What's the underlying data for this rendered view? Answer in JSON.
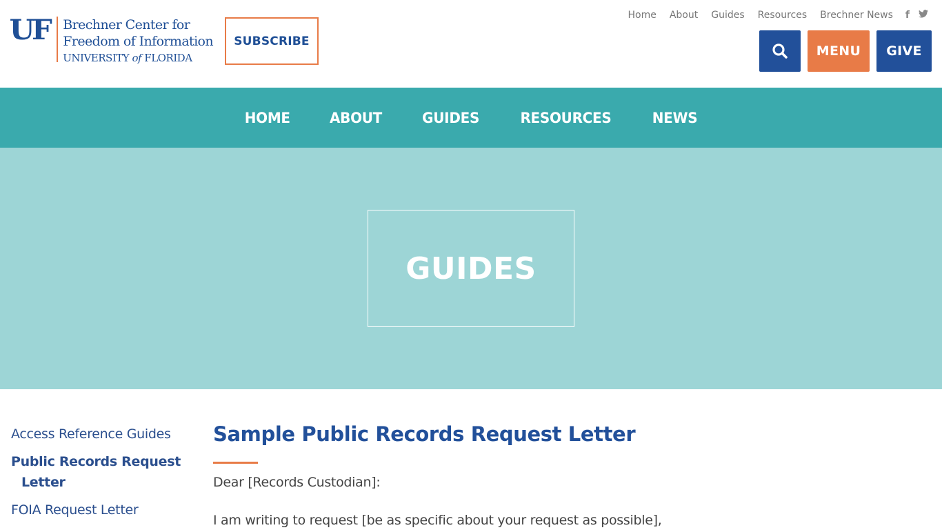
{
  "header": {
    "logo": {
      "mark": "UF",
      "line1": "Brechner Center for",
      "line2": "Freedom of Information",
      "line3_a": "UNIVERSITY ",
      "line3_of": "of",
      "line3_b": " FLORIDA"
    },
    "subscribe_label": "SUBSCRIBE",
    "top_links": [
      "Home",
      "About",
      "Guides",
      "Resources",
      "Brechner News"
    ],
    "social": {
      "facebook": "f",
      "twitter": "🐦"
    },
    "buttons": {
      "search_icon": "⚲",
      "menu_label": "MENU",
      "give_label": "GIVE"
    }
  },
  "main_nav": [
    "HOME",
    "ABOUT",
    "GUIDES",
    "RESOURCES",
    "NEWS"
  ],
  "hero": {
    "title": "GUIDES"
  },
  "sidebar": {
    "items": [
      {
        "label": "Access Reference Guides",
        "active": false
      },
      {
        "label": "Public Records Request Letter",
        "active": true
      },
      {
        "label": "FOIA Request Letter",
        "active": false
      }
    ]
  },
  "content": {
    "title": "Sample Public Records Request Letter",
    "paragraphs": [
      "Dear [Records Custodian]:",
      "I am writing to request [be as specific about your request as possible],"
    ]
  },
  "colors": {
    "brand_blue": "#22509a",
    "accent_orange": "#e87b47",
    "nav_teal": "#3aaaad",
    "hero_teal": "#9dd5d6"
  }
}
